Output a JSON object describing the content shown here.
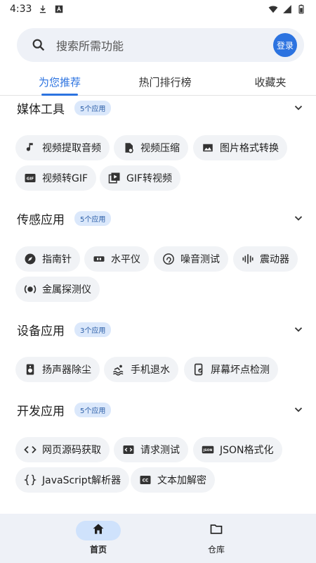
{
  "status_bar": {
    "time": "4:33",
    "icons_left": [
      "download-icon",
      "text-a-icon"
    ],
    "icons_right": [
      "wifi-icon",
      "signal-icon",
      "battery-icon"
    ]
  },
  "search": {
    "placeholder": "搜索所需功能",
    "login_label": "登录"
  },
  "tabs": [
    {
      "label": "为您推荐",
      "active": true
    },
    {
      "label": "热门排行榜",
      "active": false
    },
    {
      "label": "收藏夹",
      "active": false
    }
  ],
  "sections": [
    {
      "title": "媒体工具",
      "count": "5个应用",
      "items": [
        {
          "label": "视频提取音频",
          "icon": "music-note-icon"
        },
        {
          "label": "视频压缩",
          "icon": "video-compress-icon"
        },
        {
          "label": "图片格式转换",
          "icon": "image-icon"
        },
        {
          "label": "视频转GIF",
          "icon": "gif-icon"
        },
        {
          "label": "GIF转视频",
          "icon": "video-library-icon"
        }
      ]
    },
    {
      "title": "传感应用",
      "count": "5个应用",
      "items": [
        {
          "label": "指南针",
          "icon": "compass-icon"
        },
        {
          "label": "水平仪",
          "icon": "level-icon"
        },
        {
          "label": "噪音测试",
          "icon": "ear-icon"
        },
        {
          "label": "震动器",
          "icon": "vibration-icon"
        },
        {
          "label": "金属探测仪",
          "icon": "sensor-icon"
        }
      ]
    },
    {
      "title": "设备应用",
      "count": "3个应用",
      "items": [
        {
          "label": "扬声器除尘",
          "icon": "speaker-icon"
        },
        {
          "label": "手机退水",
          "icon": "swim-icon"
        },
        {
          "label": "屏幕坏点检测",
          "icon": "phone-check-icon"
        }
      ]
    },
    {
      "title": "开发应用",
      "count": "5个应用",
      "items": [
        {
          "label": "网页源码获取",
          "icon": "code-icon"
        },
        {
          "label": "请求测试",
          "icon": "api-icon"
        },
        {
          "label": "JSON格式化",
          "icon": "json-icon"
        },
        {
          "label": "JavaScript解析器",
          "icon": "curly-braces-icon"
        },
        {
          "label": "文本加解密",
          "icon": "cc-icon"
        }
      ]
    }
  ],
  "bottom_nav": [
    {
      "label": "首页",
      "icon": "home-icon",
      "active": true
    },
    {
      "label": "仓库",
      "icon": "folder-icon",
      "active": false
    }
  ],
  "colors": {
    "accent": "#2c73e0",
    "badge_bg": "#dbe8fb",
    "chip_bg": "#f1f3f6",
    "search_bg": "#eef1f7"
  }
}
